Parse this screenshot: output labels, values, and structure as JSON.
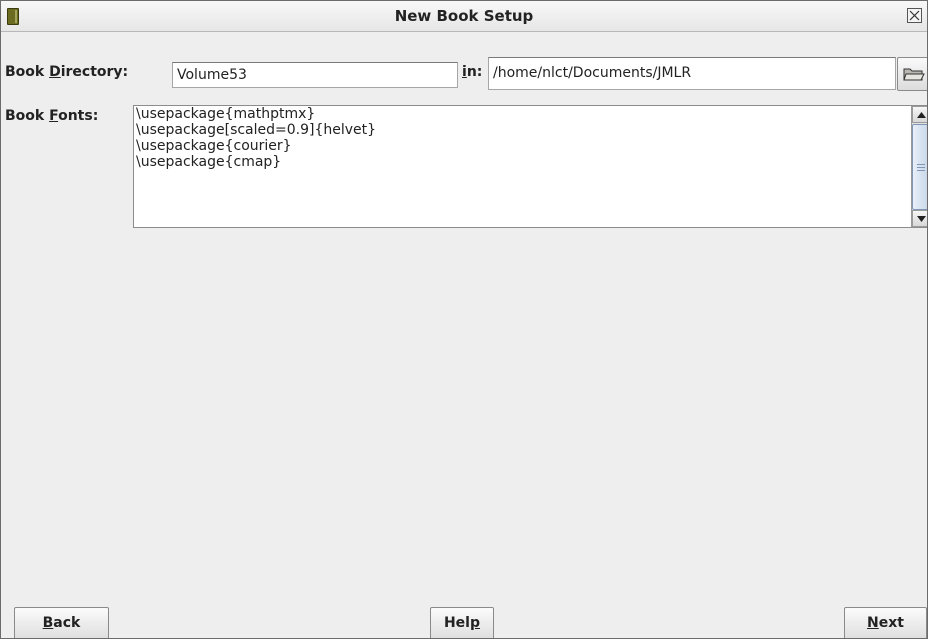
{
  "window": {
    "title": "New Book Setup"
  },
  "directory_row": {
    "label_before": "Book ",
    "label_mnemonic": "D",
    "label_after": "irectory:",
    "value": "Volume53",
    "in_label_mnemonic": "i",
    "in_label_after": "n:",
    "path_value": "/home/nlct/Documents/JMLR"
  },
  "fonts_row": {
    "label_before": "Book ",
    "label_mnemonic": "F",
    "label_after": "onts:",
    "lines": [
      "\\usepackage{mathptmx}",
      "\\usepackage[scaled=0.9]{helvet}",
      "\\usepackage{courier}",
      "\\usepackage{cmap}"
    ]
  },
  "buttons": {
    "back_mnemonic": "B",
    "back_rest": "ack",
    "help_before": "Hel",
    "help_mnemonic": "p",
    "next_mnemonic": "N",
    "next_rest": "ext"
  }
}
